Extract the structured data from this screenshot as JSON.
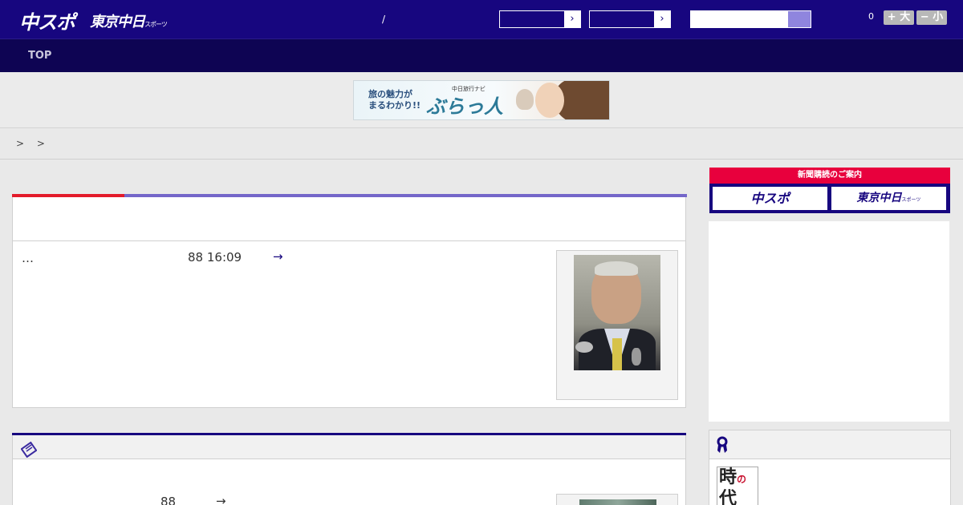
{
  "header": {
    "logo_chuspo": "中スポ",
    "logo_tokyo": "東京中日",
    "logo_tokyo_small": "スポーツ",
    "slash": "/",
    "select1_arrow": "›",
    "select2_arrow": "›",
    "search_placeholder": "",
    "counter": "0",
    "font_larger_label": "+ 大",
    "font_smaller_label": "− 小"
  },
  "nav": {
    "items": [
      {
        "label": "TOP"
      }
    ]
  },
  "banner": {
    "line1": "旅の魅力が",
    "line2": "まるわかり!!",
    "small": "中日旅行ナビ",
    "brand": "ぶらっ人"
  },
  "breadcrumb": {
    "text": "> >"
  },
  "article": {
    "ellipsis": "…",
    "date": "88 16:09",
    "more": "→"
  },
  "article2": {
    "date": "88",
    "more": "→"
  },
  "sidebar": {
    "subscribe_title": "新聞購読のご案内",
    "subscribe_btn1": "中スポ",
    "subscribe_btn2": "東京中日",
    "subscribe_btn2_small": "スポーツ",
    "thumb_text_1": "時",
    "thumb_text_red": "の",
    "thumb_text_2": "代"
  },
  "colors": {
    "header_bg": "#17067f",
    "nav_bg": "#0e0453",
    "accent_red": "#e31b2a",
    "accent_purple": "#7466c9",
    "subscribe_red": "#e8003d"
  }
}
